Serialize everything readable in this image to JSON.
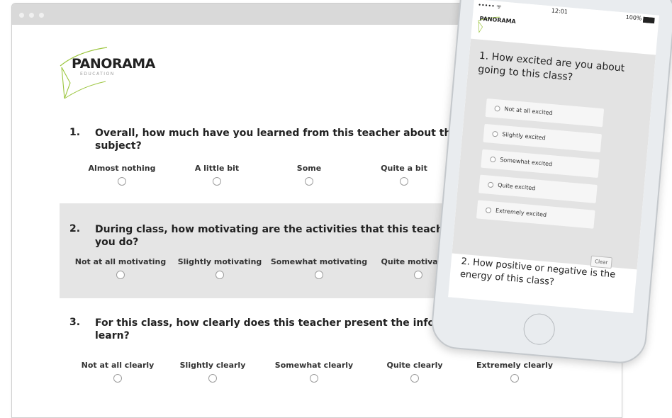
{
  "brand": {
    "name": "PANORAMA",
    "tagline": "EDUCATION"
  },
  "questions": [
    {
      "number": "1.",
      "text": "Overall, how much have you learned from this teacher about this subject?",
      "options": [
        "Almost nothing",
        "A little bit",
        "Some",
        "Quite a bit"
      ]
    },
    {
      "number": "2.",
      "text": "During class, how motivating are the activities that this teacher has you do?",
      "options": [
        "Not at all motivating",
        "Slightly motivating",
        "Somewhat motivating",
        "Quite motivating"
      ]
    },
    {
      "number": "3.",
      "text": "For this class, how clearly does this teacher present the information that you nee",
      "text_line2": "learn?",
      "options": [
        "Not at all clearly",
        "Slightly clearly",
        "Somewhat clearly",
        "Quite clearly",
        "Extremely clearly"
      ]
    }
  ],
  "mobile": {
    "status": {
      "signal": "••••• ᯤ",
      "time": "12:01",
      "battery": "100%"
    },
    "brand": "PANORAMA",
    "question1": {
      "text": "1. How excited are you about going to this class?",
      "options": [
        "Not at all excited",
        "Slightly excited",
        "Somewhat excited",
        "Quite excited",
        "Extremely excited"
      ],
      "clear_label": "Clear"
    },
    "question2": {
      "text": "2. How positive or negative is the energy of this class?"
    }
  },
  "colors": {
    "band": "#e5e5e5",
    "logo_swoosh": "#9bc53d",
    "chrome": "#d9d9d9"
  }
}
